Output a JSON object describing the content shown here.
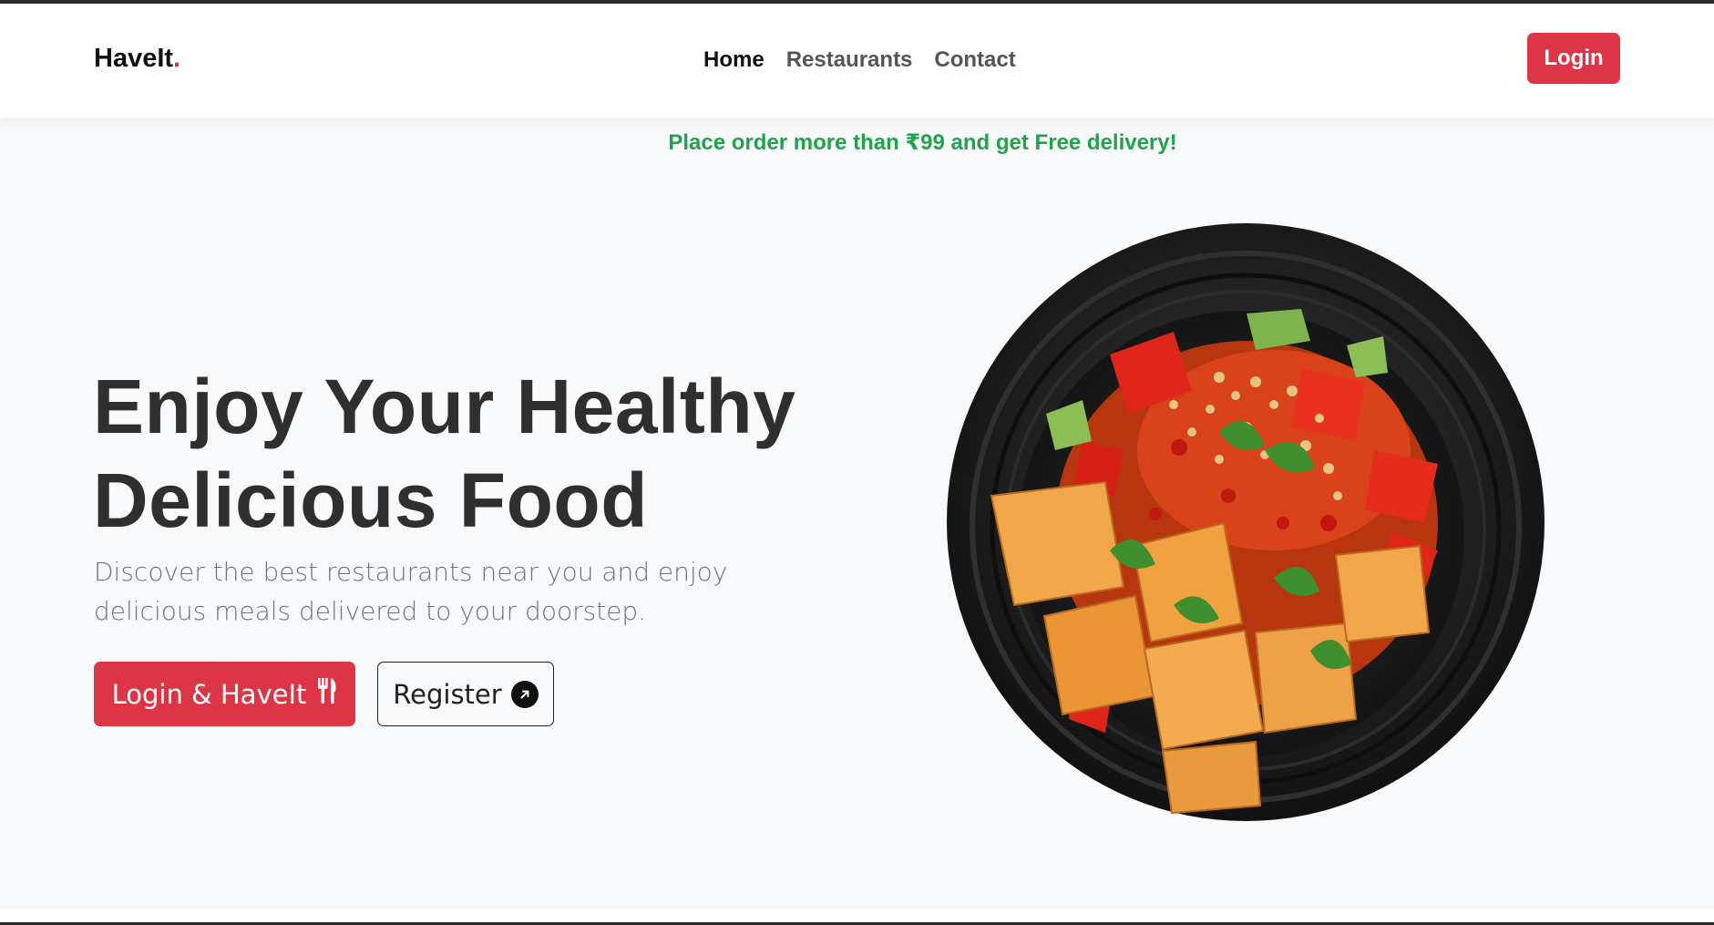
{
  "navbar": {
    "brand": "HaveIt",
    "brand_dot": ".",
    "links": [
      {
        "label": "Home",
        "active": true
      },
      {
        "label": "Restaurants",
        "active": false
      },
      {
        "label": "Contact",
        "active": false
      }
    ],
    "login_label": "Login"
  },
  "promo": {
    "text": "Place order more than ₹99 and get Free delivery!"
  },
  "hero": {
    "title_line1": "Enjoy Your Healthy",
    "title_line2": "Delicious Food",
    "subtitle": "Discover the best restaurants near you and enjoy delicious meals delivered to your doorstep.",
    "primary_button_label": "Login & HaveIt",
    "primary_button_icon": "utensils-icon",
    "secondary_button_label": "Register",
    "secondary_button_icon": "arrow-up-right-circle-icon"
  },
  "colors": {
    "accent": "#dc3545",
    "promo": "#20a44a",
    "heading": "#2f2f2f",
    "muted": "#6c757d"
  }
}
